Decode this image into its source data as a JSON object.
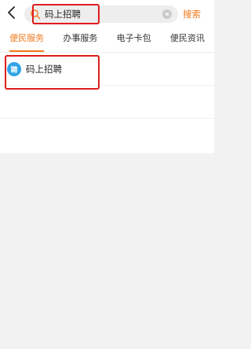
{
  "header": {
    "back_icon": "chevron-left-icon",
    "search": {
      "query": "码上招聘",
      "icon": "search-icon",
      "clear_icon": "clear-icon"
    },
    "search_button_label": "搜索",
    "accent_color": "#f07a1e"
  },
  "tabs": [
    {
      "label": "便民服务",
      "active": true
    },
    {
      "label": "办事服务",
      "active": false
    },
    {
      "label": "电子卡包",
      "active": false
    },
    {
      "label": "便民资讯",
      "active": false
    }
  ],
  "results": [
    {
      "title": "码上招聘",
      "icon": "app-icon",
      "icon_glyph": "聘"
    }
  ],
  "annotations": {
    "highlight_color": "#e11b1b"
  }
}
